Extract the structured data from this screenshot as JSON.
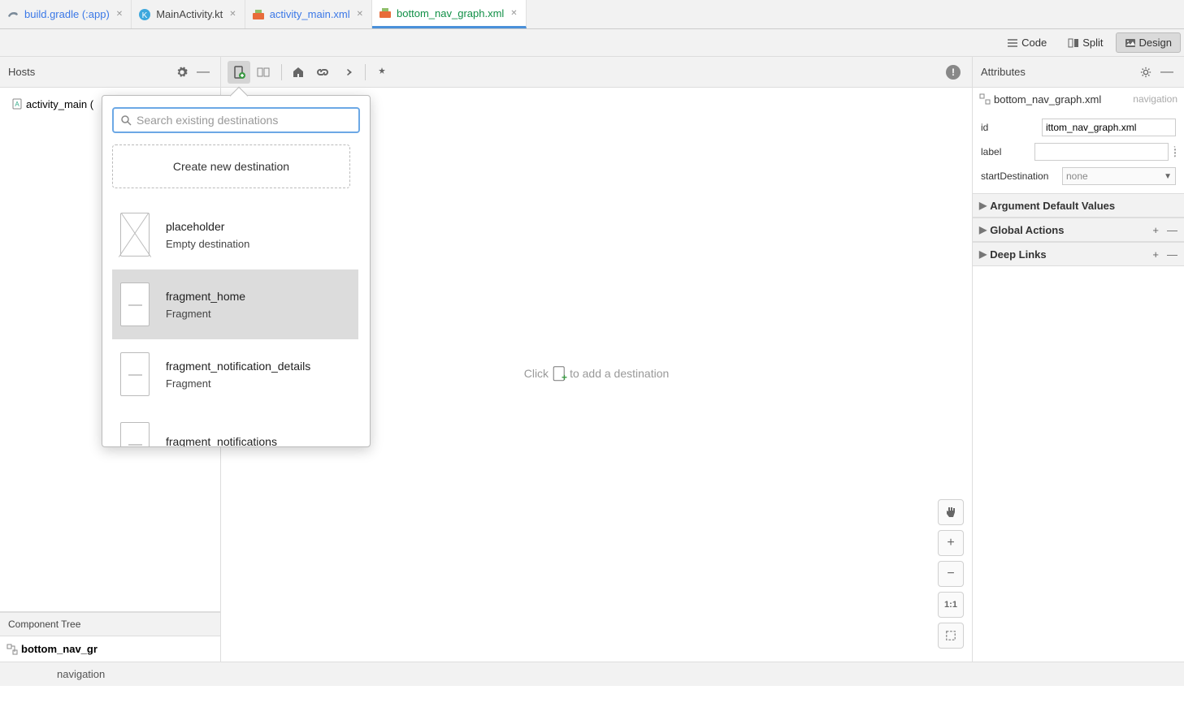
{
  "tabs": [
    {
      "label": "build.gradle (:app)",
      "active": false,
      "style": "blue-link"
    },
    {
      "label": "MainActivity.kt",
      "active": false,
      "style": ""
    },
    {
      "label": "activity_main.xml",
      "active": false,
      "style": "blue-link"
    },
    {
      "label": "bottom_nav_graph.xml",
      "active": true,
      "style": "teal-link"
    }
  ],
  "viewmodes": {
    "code": "Code",
    "split": "Split",
    "design": "Design"
  },
  "hosts": {
    "title": "Hosts",
    "item0": "activity_main ("
  },
  "component_tree": {
    "title": "Component Tree",
    "item0": "bottom_nav_gr"
  },
  "canvas": {
    "hint_before": "Click",
    "hint_after": "to add a destination"
  },
  "popup": {
    "search_placeholder": "Search existing destinations",
    "create_label": "Create new destination",
    "items": [
      {
        "title": "placeholder",
        "sub": "Empty destination",
        "thumb": "placeholder"
      },
      {
        "title": "fragment_home",
        "sub": "Fragment",
        "thumb": "fragment",
        "selected": true
      },
      {
        "title": "fragment_notification_details",
        "sub": "Fragment",
        "thumb": "fragment"
      },
      {
        "title": "fragment_notifications",
        "sub": "",
        "thumb": "fragment"
      }
    ]
  },
  "attributes": {
    "title": "Attributes",
    "filename": "bottom_nav_graph.xml",
    "filetype": "navigation",
    "fields": {
      "id_label": "id",
      "id_value": "ittom_nav_graph.xml",
      "label_label": "label",
      "label_value": "",
      "startdest_label": "startDestination",
      "startdest_value": "none"
    },
    "sections": {
      "argdef": "Argument Default Values",
      "global": "Global Actions",
      "deeplinks": "Deep Links"
    }
  },
  "zoom": {
    "oneToOne": "1:1"
  },
  "bottom": {
    "breadcrumb": "navigation"
  }
}
